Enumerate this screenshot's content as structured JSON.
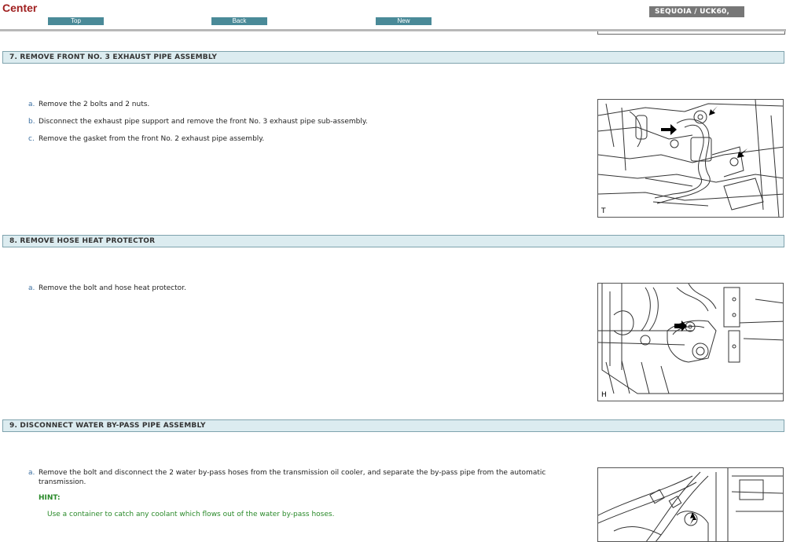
{
  "header": {
    "brand": "Center",
    "nav": {
      "top": "Top",
      "back": "Back",
      "new": "New"
    },
    "model": "SEQUOIA / UCK60,"
  },
  "sections": [
    {
      "title": "7. REMOVE FRONT NO. 3 EXHAUST PIPE ASSEMBLY",
      "steps": [
        {
          "letter": "a.",
          "text": "Remove the 2 bolts and 2 nuts."
        },
        {
          "letter": "b.",
          "text": "Disconnect the exhaust pipe support and remove the front No. 3 exhaust pipe sub-assembly."
        },
        {
          "letter": "c.",
          "text": "Remove the gasket from the front No. 2 exhaust pipe assembly."
        }
      ],
      "figure_label": "T"
    },
    {
      "title": "8. REMOVE HOSE HEAT PROTECTOR",
      "steps": [
        {
          "letter": "a.",
          "text": "Remove the bolt and hose heat protector."
        }
      ],
      "figure_label": "H"
    },
    {
      "title": "9. DISCONNECT WATER BY-PASS PIPE ASSEMBLY",
      "steps": [
        {
          "letter": "a.",
          "text": "Remove the bolt and disconnect the 2 water by-pass hoses from the transmission oil cooler, and separate the by-pass pipe from the automatic transmission."
        }
      ],
      "hint_label": "HINT:",
      "hint_text": "Use a container to catch any coolant which flows out of the water by-pass hoses."
    }
  ]
}
